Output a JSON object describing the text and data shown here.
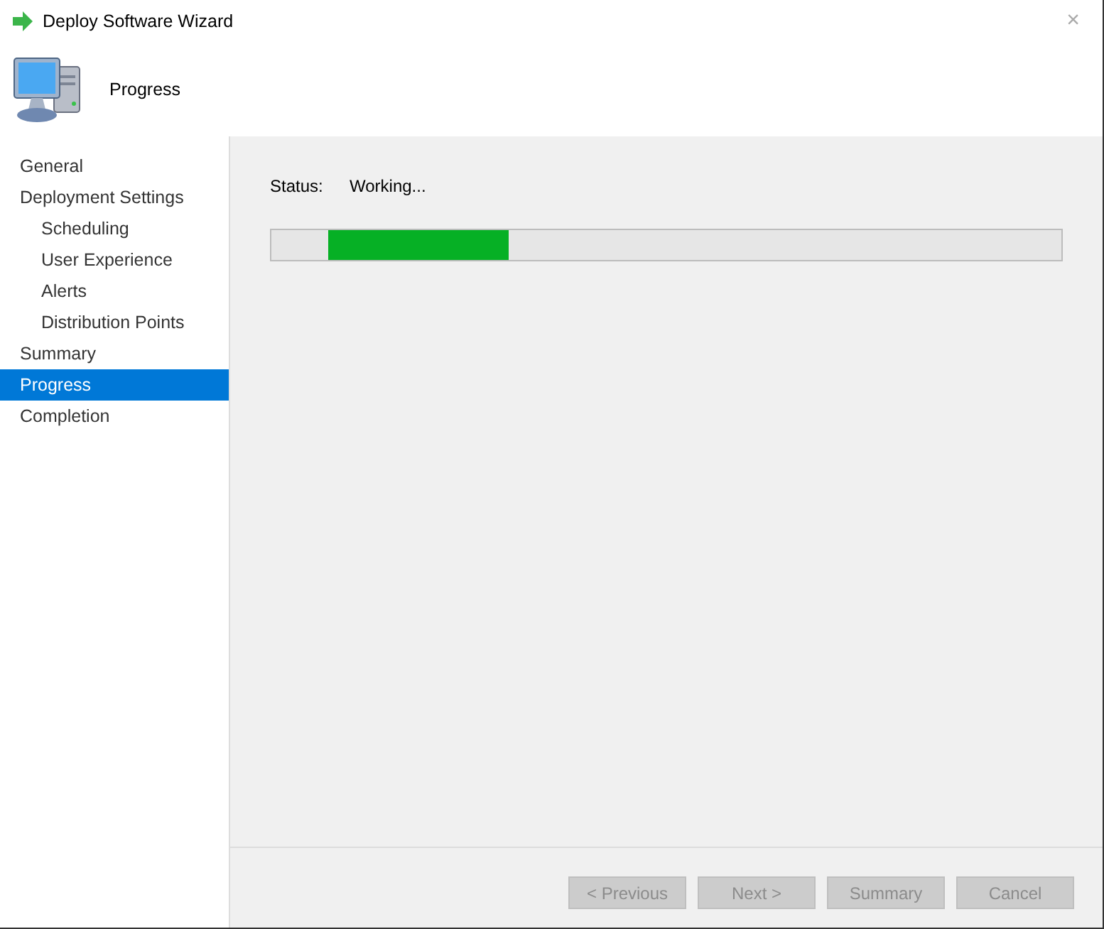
{
  "window": {
    "title": "Deploy Software Wizard",
    "close": "×"
  },
  "header": {
    "title": "Progress"
  },
  "sidebar": {
    "items": [
      {
        "label": "General",
        "selected": false
      },
      {
        "label": "Deployment Settings",
        "selected": false,
        "children": [
          {
            "label": "Scheduling",
            "selected": false
          },
          {
            "label": "User Experience",
            "selected": false
          },
          {
            "label": "Alerts",
            "selected": false
          },
          {
            "label": "Distribution Points",
            "selected": false
          }
        ]
      },
      {
        "label": "Summary",
        "selected": false
      },
      {
        "label": "Progress",
        "selected": true
      },
      {
        "label": "Completion",
        "selected": false
      }
    ]
  },
  "status": {
    "label": "Status:",
    "value": "Working..."
  },
  "progress": {
    "kind": "marquee"
  },
  "buttons": [
    {
      "label": "< Previous",
      "disabled": true
    },
    {
      "label": "Next >",
      "disabled": true
    },
    {
      "label": "Summary",
      "disabled": true
    },
    {
      "label": "Cancel",
      "disabled": true
    }
  ]
}
